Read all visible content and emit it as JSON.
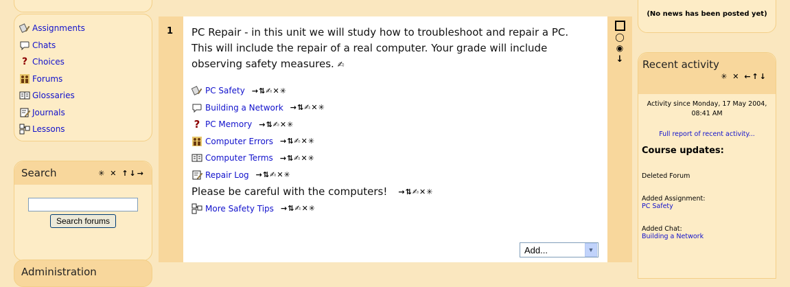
{
  "activities": [
    {
      "icon": "assignment-icon",
      "label": "Assignments"
    },
    {
      "icon": "chat-icon",
      "label": "Chats"
    },
    {
      "icon": "choice-icon",
      "label": "Choices"
    },
    {
      "icon": "forum-icon",
      "label": "Forums"
    },
    {
      "icon": "glossary-icon",
      "label": "Glossaries"
    },
    {
      "icon": "journal-icon",
      "label": "Journals"
    },
    {
      "icon": "lesson-icon",
      "label": "Lessons"
    }
  ],
  "search": {
    "title": "Search",
    "controls": "✳ ✕ ↑↓→",
    "input_value": "",
    "button": "Search forums"
  },
  "admin": {
    "title": "Administration"
  },
  "section": {
    "number": "1",
    "summary": "PC Repair - in this unit we will study how to troubleshoot and repair a PC. This will include the repair of a real computer. Your grade will include observing safety measures.",
    "edit_icons": "→⇅✍✕✳",
    "modules": [
      {
        "icon": "assignment-icon",
        "label": "PC Safety"
      },
      {
        "icon": "chat-icon",
        "label": "Building a Network"
      },
      {
        "icon": "choice-icon",
        "label": "PC Memory"
      },
      {
        "icon": "forum-icon",
        "label": "Computer Errors"
      },
      {
        "icon": "glossary-icon",
        "label": "Computer Terms"
      },
      {
        "icon": "journal-icon",
        "label": "Repair Log"
      }
    ],
    "label_text": "Please be careful with the computers!",
    "last_module": {
      "icon": "lesson-icon",
      "label": "More Safety Tips"
    },
    "add_select": "Add..."
  },
  "news": {
    "text": "(No news has been posted yet)"
  },
  "recent": {
    "title": "Recent activity",
    "controls": "✳ ✕ ←↑↓",
    "since": "Activity since Monday, 17 May 2004, 08:41 AM",
    "full_report": "Full report of recent activity...",
    "updates_title": "Course updates:",
    "items": [
      {
        "text": "Deleted Forum",
        "link": ""
      },
      {
        "text": "Added Assignment:",
        "link": "PC Safety"
      },
      {
        "text": "Added Chat:",
        "link": "Building a Network"
      }
    ]
  }
}
